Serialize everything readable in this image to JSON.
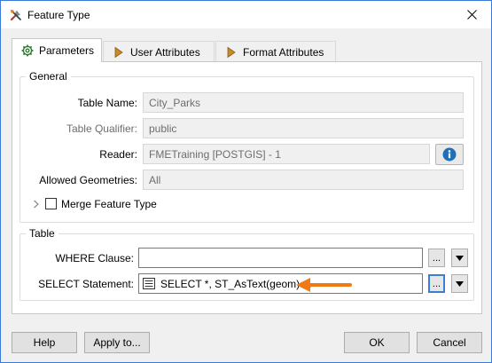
{
  "window": {
    "title": "Feature Type",
    "icon": "tools-icon",
    "close_icon": "close-icon"
  },
  "tabs": [
    {
      "label": "Parameters",
      "icon": "gear-icon",
      "active": true
    },
    {
      "label": "User Attributes",
      "icon": "arrow-right-icon",
      "active": false
    },
    {
      "label": "Format Attributes",
      "icon": "arrow-right-icon",
      "active": false
    }
  ],
  "general": {
    "legend": "General",
    "table_name": {
      "label": "Table Name:",
      "value": "City_Parks"
    },
    "table_qualifier": {
      "label": "Table Qualifier:",
      "value": "public"
    },
    "reader": {
      "label": "Reader:",
      "value": "FMETraining [POSTGIS] - 1",
      "info_icon": "info-icon"
    },
    "allowed_geometries": {
      "label": "Allowed Geometries:",
      "value": "All"
    },
    "merge_feature_type": {
      "label": "Merge Feature Type",
      "checked": false
    }
  },
  "table": {
    "legend": "Table",
    "where_clause": {
      "label": "WHERE Clause:",
      "value": "",
      "browse_label": "..."
    },
    "select_statement": {
      "label": "SELECT Statement:",
      "value": "SELECT *, ST_AsText(geom) ...",
      "browse_label": "...",
      "icon": "list-icon"
    }
  },
  "annotation": {
    "arrow_color": "#f07a14"
  },
  "footer": {
    "help": "Help",
    "apply_to": "Apply to...",
    "ok": "OK",
    "cancel": "Cancel"
  }
}
